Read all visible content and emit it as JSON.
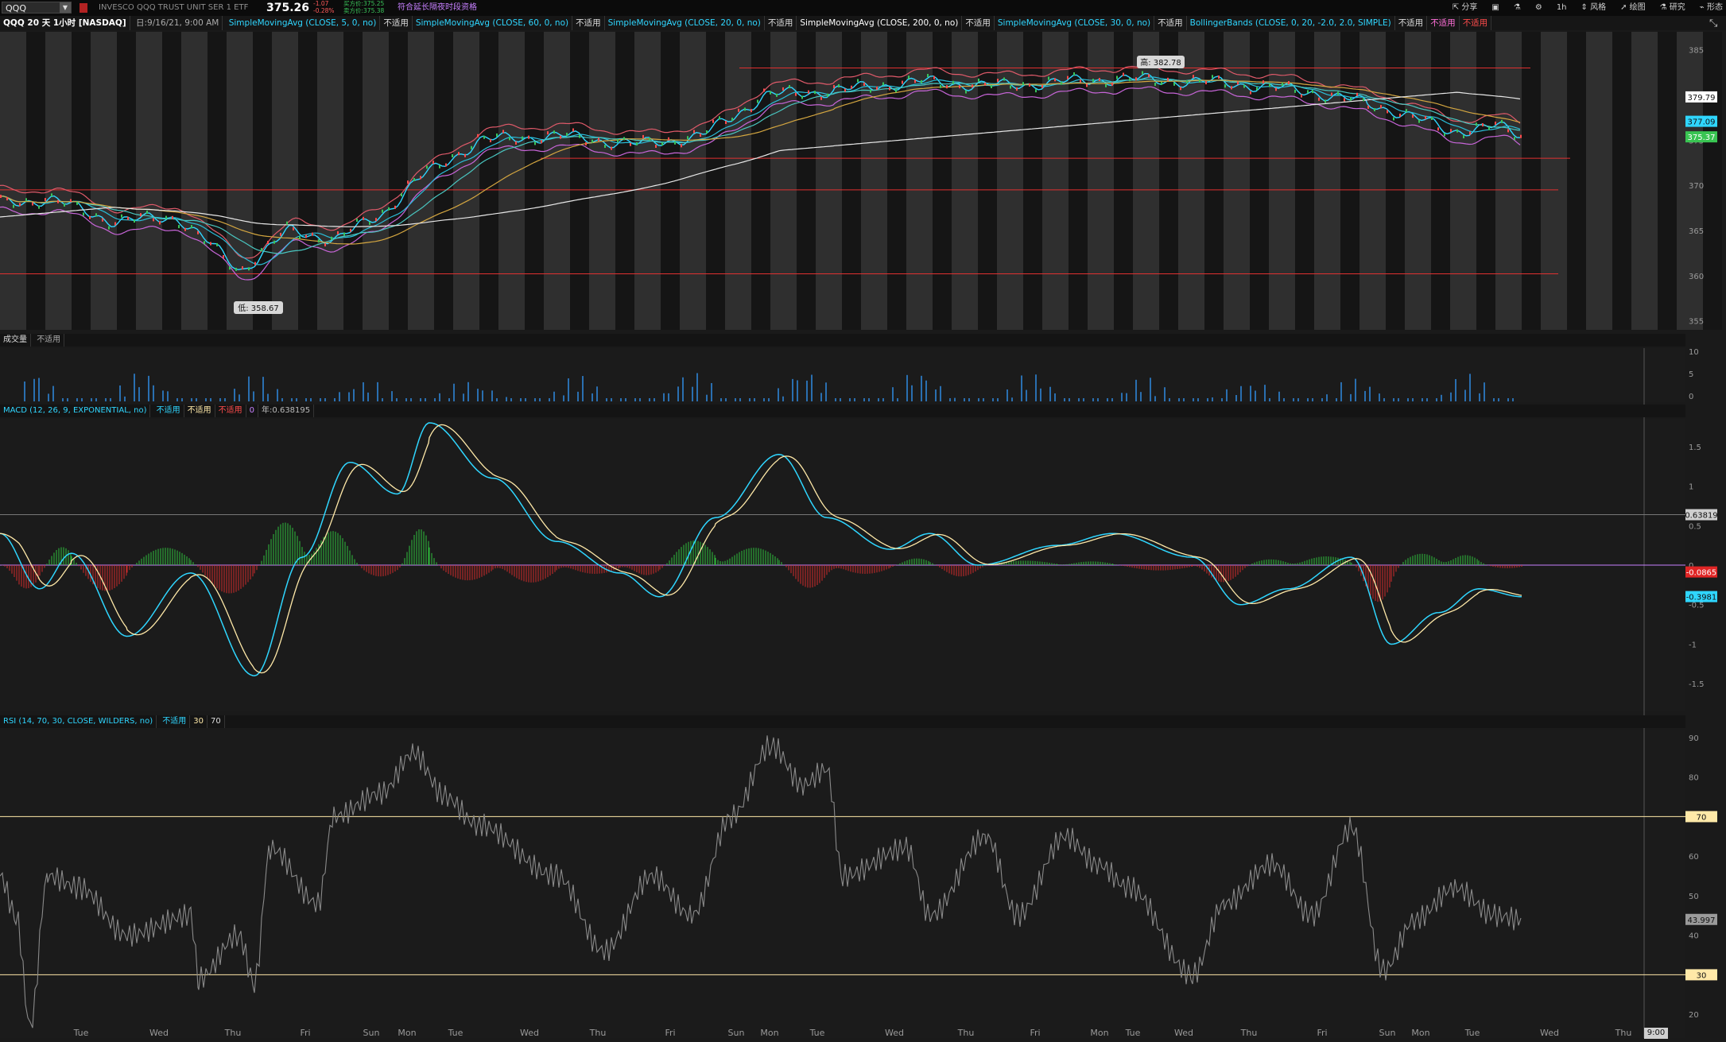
{
  "header": {
    "symbol": "QQQ",
    "instrument_name": "INVESCO QQQ TRUST UNIT SER 1 ETF",
    "last_price": "375.26",
    "change": "-1.07",
    "change_pct": "-0.28%",
    "bid": "买方价:375.25",
    "ask": "卖方价:375.38",
    "extended_hours": "符合延长隔夜时段资格",
    "toolbar": [
      "分享",
      "",
      "",
      "",
      "1h",
      "风格",
      "绘图",
      "研究",
      "形态"
    ]
  },
  "studies": {
    "title": "QQQ 20 天 1小时 [NASDAQ]",
    "date": "日:9/16/21, 9:00 AM",
    "items": [
      {
        "label": "SimpleMovingAvg (CLOSE, 5, 0, no)",
        "color": "#2fd6ff",
        "value": "不适用"
      },
      {
        "label": "SimpleMovingAvg (CLOSE, 60, 0, no)",
        "color": "#2fd6ff",
        "value": "不适用"
      },
      {
        "label": "SimpleMovingAvg (CLOSE, 20, 0, no)",
        "color": "#2fd6ff",
        "value": "不适用"
      },
      {
        "label": "SimpleMovingAvg (CLOSE, 200, 0, no)",
        "color": "#ffffff",
        "value": "不适用"
      },
      {
        "label": "SimpleMovingAvg (CLOSE, 30, 0, no)",
        "color": "#2fd6ff",
        "value": "不适用"
      },
      {
        "label": "BollingerBands (CLOSE, 0, 20, -2.0, 2.0, SIMPLE)",
        "color": "#2fd6ff",
        "value": "不适用"
      }
    ],
    "extra_values": [
      {
        "text": "不适用",
        "color": "#ff6fd8"
      },
      {
        "text": "不适用",
        "color": "#ff4b4b"
      }
    ]
  },
  "price_pane": {
    "high_label": "高: 382.78",
    "low_label": "低: 358.67",
    "y_ticks": [
      "385",
      "380",
      "375",
      "370",
      "365",
      "360",
      "355"
    ],
    "price_tags": [
      {
        "text": "379.79",
        "bg": "#ffffff",
        "fg": "#111111"
      },
      {
        "text": "377.09",
        "bg": "#2fd6ff",
        "fg": "#111111"
      },
      {
        "text": "375.37",
        "bg": "#39c552",
        "fg": "#ffffff"
      }
    ]
  },
  "volume_pane": {
    "label": "成交量",
    "value": "不适用",
    "y_ticks": [
      "10",
      "5",
      "0"
    ]
  },
  "macd_pane": {
    "label": "MACD (12, 26, 9, EXPONENTIAL, no)",
    "values": [
      {
        "text": "不适用",
        "color": "#2fd6ff"
      },
      {
        "text": "不适用",
        "color": "#ffe9a8"
      },
      {
        "text": "不适用",
        "color": "#ff4b4b"
      },
      {
        "text": "0",
        "color": "#c780ff"
      },
      {
        "text": "年:0.638195",
        "color": "#bbbbbb"
      }
    ],
    "y_ticks": [
      "1.5",
      "1",
      "0.5",
      "0",
      "-0.5",
      "-1",
      "-1.5"
    ],
    "tags": [
      {
        "text": "0.63819",
        "bg": "#cfcfcf",
        "fg": "#111111"
      },
      {
        "text": "-0.0865",
        "bg": "#e02525",
        "fg": "#ffffff"
      },
      {
        "text": "-0.3981",
        "bg": "#2fd6ff",
        "fg": "#111111"
      }
    ]
  },
  "rsi_pane": {
    "label": "RSI (14, 70, 30, CLOSE, WILDERS, no)",
    "values": [
      {
        "text": "不适用",
        "color": "#2fd6ff"
      },
      {
        "text": "30",
        "color": "#ffe9a8"
      },
      {
        "text": "70",
        "color": "#dddddd"
      }
    ],
    "y_ticks": [
      "90",
      "80",
      "70",
      "60",
      "50",
      "40",
      "30",
      "20"
    ],
    "tags": [
      {
        "text": "70",
        "bg": "#ffe9a8",
        "fg": "#111111"
      },
      {
        "text": "43.997",
        "bg": "#9a9a9a",
        "fg": "#111111"
      },
      {
        "text": "30",
        "bg": "#ffe9a8",
        "fg": "#111111"
      }
    ]
  },
  "x_axis": {
    "labels": [
      "Tue",
      "Wed",
      "Thu",
      "Fri",
      "Sun",
      "Mon",
      "Tue",
      "Wed",
      "Thu",
      "Fri",
      "Sun",
      "Mon",
      "Tue",
      "Wed",
      "Thu",
      "Fri",
      "Mon",
      "Tue",
      "Wed",
      "Thu",
      "Fri",
      "Sun",
      "Mon",
      "Tue",
      "Wed",
      "Thu"
    ],
    "time_badge": "9:00"
  }
}
